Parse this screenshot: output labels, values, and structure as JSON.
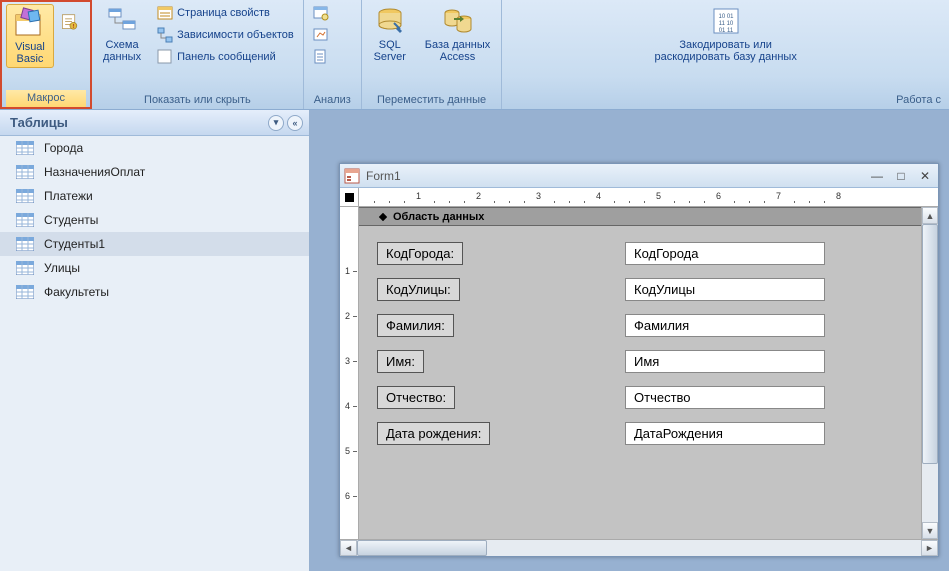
{
  "ribbon": {
    "groups": {
      "macros": {
        "label": "Макрос",
        "visual_basic": "Visual\nBasic"
      },
      "show_hide": {
        "label": "Показать или скрыть",
        "schema": "Схема\nданных",
        "properties": "Страница свойств",
        "dependencies": "Зависимости объектов",
        "messages": "Панель сообщений"
      },
      "analyze": {
        "label": "Анализ"
      },
      "move_data": {
        "label": "Переместить данные",
        "sql": "SQL\nServer",
        "access_db": "База данных\nAccess"
      },
      "db_tools": {
        "label": "Работа с",
        "encode": "Закодировать или\nраскодировать базу данных"
      }
    }
  },
  "nav": {
    "header": "Таблицы",
    "items": [
      {
        "label": "Города",
        "selected": false
      },
      {
        "label": "НазначенияОплат",
        "selected": false
      },
      {
        "label": "Платежи",
        "selected": false
      },
      {
        "label": "Студенты",
        "selected": false
      },
      {
        "label": "Студенты1",
        "selected": true
      },
      {
        "label": "Улицы",
        "selected": false
      },
      {
        "label": "Факультеты",
        "selected": false
      }
    ]
  },
  "form": {
    "title": "Form1",
    "section_header": "Область данных",
    "fields": [
      {
        "label": "КодГорода:",
        "value": "КодГорода"
      },
      {
        "label": "КодУлицы:",
        "value": "КодУлицы"
      },
      {
        "label": "Фамилия:",
        "value": "Фамилия"
      },
      {
        "label": "Имя:",
        "value": "Имя"
      },
      {
        "label": "Отчество:",
        "value": "Отчество"
      },
      {
        "label": "Дата рождения:",
        "value": "ДатаРождения"
      }
    ],
    "h_ruler_marks": [
      "1",
      "2",
      "3",
      "4",
      "5",
      "6",
      "7",
      "8"
    ],
    "v_ruler_marks": [
      "1",
      "2",
      "3",
      "4",
      "5",
      "6"
    ]
  }
}
